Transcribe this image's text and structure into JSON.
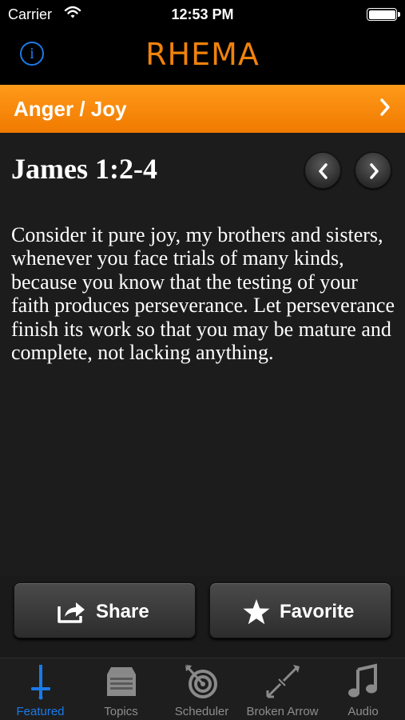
{
  "status_bar": {
    "carrier": "Carrier",
    "time": "12:53 PM"
  },
  "nav": {
    "title": "RHEMA",
    "info_icon": "i"
  },
  "category": {
    "label": "Anger / Joy"
  },
  "verse": {
    "reference": "James 1:2-4",
    "text": "Consider it pure joy, my brothers and sisters, whenever you face trials of many kinds, because you know that the testing of your faith produces perseverance. Let perseverance finish its work so that you may be mature and complete, not lacking anything."
  },
  "actions": {
    "share_label": "Share",
    "favorite_label": "Favorite"
  },
  "tabs": [
    {
      "label": "Featured",
      "icon": "sword-icon",
      "active": true
    },
    {
      "label": "Topics",
      "icon": "box-icon",
      "active": false
    },
    {
      "label": "Scheduler",
      "icon": "target-icon",
      "active": false
    },
    {
      "label": "Broken Arrow",
      "icon": "arrow-icon",
      "active": false
    },
    {
      "label": "Audio",
      "icon": "music-note-icon",
      "active": false
    }
  ],
  "colors": {
    "accent_orange": "#f0820c",
    "accent_blue": "#1a7ae8",
    "background": "#1c1c1c"
  }
}
